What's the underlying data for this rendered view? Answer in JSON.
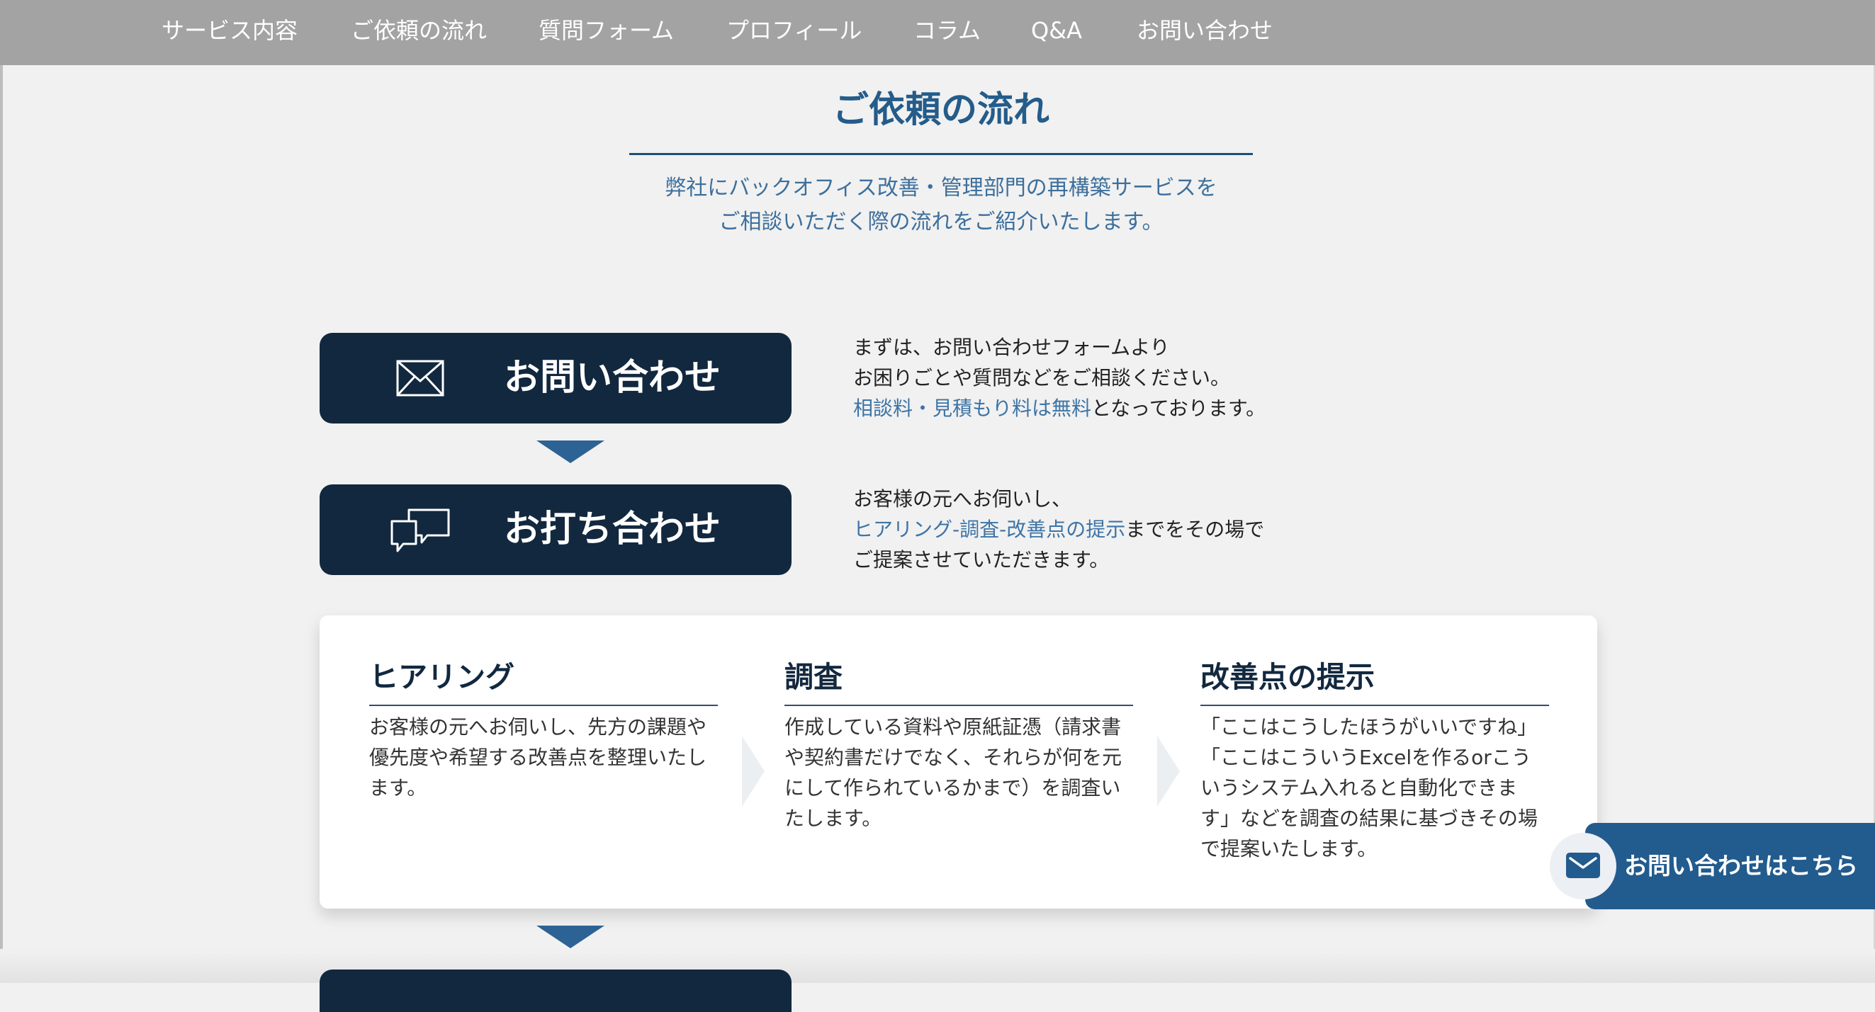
{
  "nav": {
    "items": [
      {
        "label": "サービス内容"
      },
      {
        "label": "ご依頼の流れ"
      },
      {
        "label": "質問フォーム"
      },
      {
        "label": "プロフィール"
      },
      {
        "label": "コラム"
      },
      {
        "label": "Q&A"
      },
      {
        "label": "お問い合わせ"
      }
    ]
  },
  "section": {
    "title": "ご依頼の流れ",
    "lead_line1": "弊社にバックオフィス改善・管理部門の再構築サービスを",
    "lead_line2": "ご相談いただく際の流れをご紹介いたします。"
  },
  "steps": [
    {
      "label": "お問い合わせ",
      "icon": "envelope-icon",
      "line1": "まずは、お問い合わせフォームより",
      "line2": "お困りごとや質問などをご相談ください。",
      "line3_accent": "相談料・見積もり料は無料",
      "line3_rest": "となっております。"
    },
    {
      "label": "お打ち合わせ",
      "icon": "chat-bubbles-icon",
      "line1": "お客様の元へお伺いし、",
      "line2_accent": "ヒアリング-調査-改善点の提示",
      "line2_rest": "までをその場で",
      "line3": "ご提案させていただきます。"
    }
  ],
  "meeting_details": [
    {
      "title": "ヒアリング",
      "lines": [
        "お客様の元へお伺いし、先方の課題や",
        "優先度や希望する改善点を整理いたし",
        "ます。"
      ]
    },
    {
      "title": "調査",
      "lines": [
        "作成している資料や原紙証憑（請求書",
        "や契約書だけでなく、それらが何を元",
        "にして作られているかまで）を調査い",
        "たします。"
      ]
    },
    {
      "title": "改善点の提示",
      "lines": [
        "「ここはこうしたほうがいいですね」",
        "「ここはこういうExcelを作るorこう",
        "いうシステム入れると自動化できま",
        "す」などを調査の結果に基づきその場",
        "で提案いたします。"
      ]
    }
  ],
  "cta": {
    "label": "お問い合わせはこちら",
    "icon": "envelope-icon"
  },
  "colors": {
    "nav_bg": "#a3a3a3",
    "navy": "#12283f",
    "accent_blue": "#225b8e",
    "page_bg": "#f1f1f1"
  }
}
